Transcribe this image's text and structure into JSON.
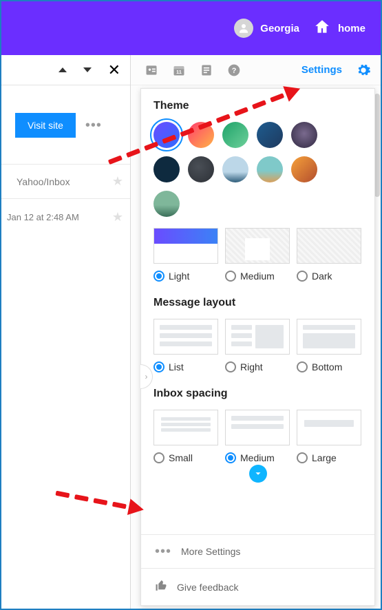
{
  "header": {
    "user_name": "Georgia",
    "home_label": "home"
  },
  "left": {
    "visit_button": "Visit site",
    "inbox_label": "Yahoo/Inbox",
    "timestamp": "Jan 12 at 2:48 AM"
  },
  "toolbar": {
    "settings_label": "Settings"
  },
  "panel": {
    "theme_title": "Theme",
    "theme_swatches": [
      {
        "bg": "linear-gradient(135deg,#6a4cff,#2f6bff)",
        "selected": true
      },
      {
        "bg": "linear-gradient(135deg,#ff3d6e,#ffb347)"
      },
      {
        "bg": "linear-gradient(135deg,#1fa36a,#6ed09a)"
      },
      {
        "bg": "linear-gradient(135deg,#1e5c8f,#1e3a5f)"
      },
      {
        "bg": "radial-gradient(circle at 50% 45%,#7a6a8e,#2f2740)"
      },
      {
        "bg": "#0e2a3f"
      },
      {
        "bg": "radial-gradient(circle at 40% 40%,#4a4f56,#2c3036)"
      },
      {
        "bg": "linear-gradient(#bcd7e8 60%,#2e5d7a)"
      },
      {
        "bg": "linear-gradient(#7fc9c9 55%,#d9a05b)"
      },
      {
        "bg": "linear-gradient(135deg,#f6a13a,#b24d2e)"
      },
      {
        "bg": "linear-gradient(#7fb79a 55%,#3a6e58)"
      }
    ],
    "modes": {
      "light": "Light",
      "medium": "Medium",
      "dark": "Dark",
      "selected": "light"
    },
    "layout_title": "Message layout",
    "layouts": {
      "list": "List",
      "right": "Right",
      "bottom": "Bottom",
      "selected": "list"
    },
    "spacing_title": "Inbox spacing",
    "spacing": {
      "small": "Small",
      "medium": "Medium",
      "large": "Large",
      "selected": "medium"
    }
  },
  "footer": {
    "more_settings": "More Settings",
    "feedback": "Give feedback"
  }
}
